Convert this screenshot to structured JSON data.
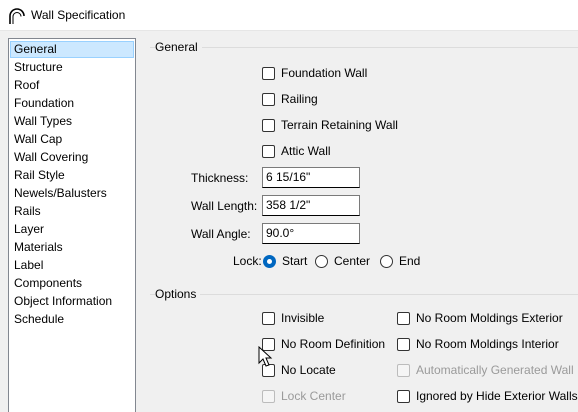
{
  "window": {
    "title": "Wall Specification",
    "icon": "wall-arc-icon"
  },
  "sidebar": {
    "items": [
      {
        "label": "General",
        "selected": true
      },
      {
        "label": "Structure"
      },
      {
        "label": "Roof"
      },
      {
        "label": "Foundation"
      },
      {
        "label": "Wall Types"
      },
      {
        "label": "Wall Cap"
      },
      {
        "label": "Wall Covering"
      },
      {
        "label": "Rail Style"
      },
      {
        "label": "Newels/Balusters"
      },
      {
        "label": "Rails"
      },
      {
        "label": "Layer"
      },
      {
        "label": "Materials"
      },
      {
        "label": "Label"
      },
      {
        "label": "Components"
      },
      {
        "label": "Object Information"
      },
      {
        "label": "Schedule"
      }
    ]
  },
  "general": {
    "heading": "General",
    "checkboxes": {
      "foundation_wall": {
        "label": "Foundation Wall",
        "checked": false
      },
      "railing": {
        "label": "Railing",
        "checked": false
      },
      "terrain_retaining_wall": {
        "label": "Terrain Retaining Wall",
        "checked": false
      },
      "attic_wall": {
        "label": "Attic Wall",
        "checked": false
      }
    },
    "thickness": {
      "label": "Thickness:",
      "value": "6 15/16\""
    },
    "wall_length": {
      "label": "Wall Length:",
      "value": "358 1/2\""
    },
    "wall_angle": {
      "label": "Wall Angle:",
      "value": "90.0°"
    },
    "lock": {
      "label": "Lock:",
      "options": [
        "Start",
        "Center",
        "End"
      ],
      "selected": "Start"
    }
  },
  "options": {
    "heading": "Options",
    "invisible": {
      "label": "Invisible",
      "checked": false
    },
    "no_room_definition": {
      "label": "No Room Definition",
      "checked": false
    },
    "no_locate": {
      "label": "No Locate",
      "checked": false
    },
    "lock_center": {
      "label": "Lock Center",
      "checked": false,
      "disabled": true
    },
    "no_room_moldings_exterior": {
      "label": "No Room Moldings Exterior",
      "checked": false
    },
    "no_room_moldings_interior": {
      "label": "No Room Moldings Interior",
      "checked": false
    },
    "automatically_generated_wall": {
      "label": "Automatically Generated Wall",
      "checked": false,
      "disabled": true
    },
    "ignored_by_hide_exterior_walls": {
      "label": "Ignored by Hide Exterior Walls",
      "checked": false
    }
  },
  "colors": {
    "selection_bg": "#cce8ff",
    "selection_border": "#99d1ff",
    "radio_accent": "#0067c0",
    "dialog_bg": "#f0f0f0"
  }
}
